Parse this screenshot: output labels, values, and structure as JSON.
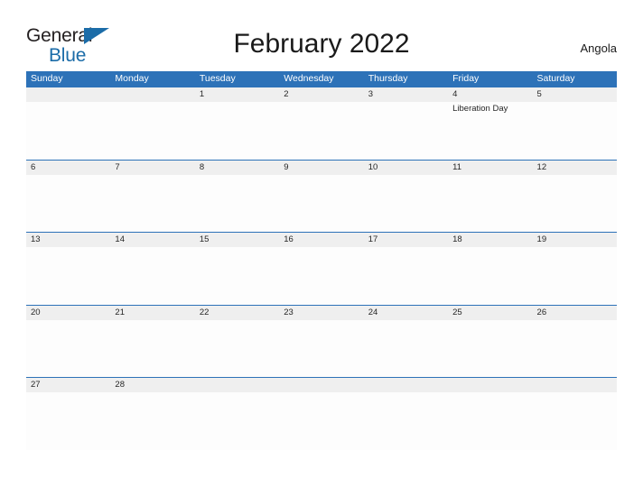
{
  "brand": {
    "name_part1": "General",
    "name_part2": "Blue",
    "flag_icon": "blue-triangle-flag-icon",
    "primary_color": "#1b6ca8"
  },
  "header": {
    "title": "February 2022",
    "country": "Angola",
    "accent_color": "#2d72b8",
    "band_color": "#efefef"
  },
  "calendar": {
    "month": "February",
    "year": "2022",
    "weekday_headers": [
      "Sunday",
      "Monday",
      "Tuesday",
      "Wednesday",
      "Thursday",
      "Friday",
      "Saturday"
    ],
    "weeks": [
      [
        {
          "date": "",
          "events": []
        },
        {
          "date": "",
          "events": []
        },
        {
          "date": "1",
          "events": []
        },
        {
          "date": "2",
          "events": []
        },
        {
          "date": "3",
          "events": []
        },
        {
          "date": "4",
          "events": [
            "Liberation Day"
          ]
        },
        {
          "date": "5",
          "events": []
        }
      ],
      [
        {
          "date": "6",
          "events": []
        },
        {
          "date": "7",
          "events": []
        },
        {
          "date": "8",
          "events": []
        },
        {
          "date": "9",
          "events": []
        },
        {
          "date": "10",
          "events": []
        },
        {
          "date": "11",
          "events": []
        },
        {
          "date": "12",
          "events": []
        }
      ],
      [
        {
          "date": "13",
          "events": []
        },
        {
          "date": "14",
          "events": []
        },
        {
          "date": "15",
          "events": []
        },
        {
          "date": "16",
          "events": []
        },
        {
          "date": "17",
          "events": []
        },
        {
          "date": "18",
          "events": []
        },
        {
          "date": "19",
          "events": []
        }
      ],
      [
        {
          "date": "20",
          "events": []
        },
        {
          "date": "21",
          "events": []
        },
        {
          "date": "22",
          "events": []
        },
        {
          "date": "23",
          "events": []
        },
        {
          "date": "24",
          "events": []
        },
        {
          "date": "25",
          "events": []
        },
        {
          "date": "26",
          "events": []
        }
      ],
      [
        {
          "date": "27",
          "events": []
        },
        {
          "date": "28",
          "events": []
        },
        {
          "date": "",
          "events": []
        },
        {
          "date": "",
          "events": []
        },
        {
          "date": "",
          "events": []
        },
        {
          "date": "",
          "events": []
        },
        {
          "date": "",
          "events": []
        }
      ]
    ]
  }
}
